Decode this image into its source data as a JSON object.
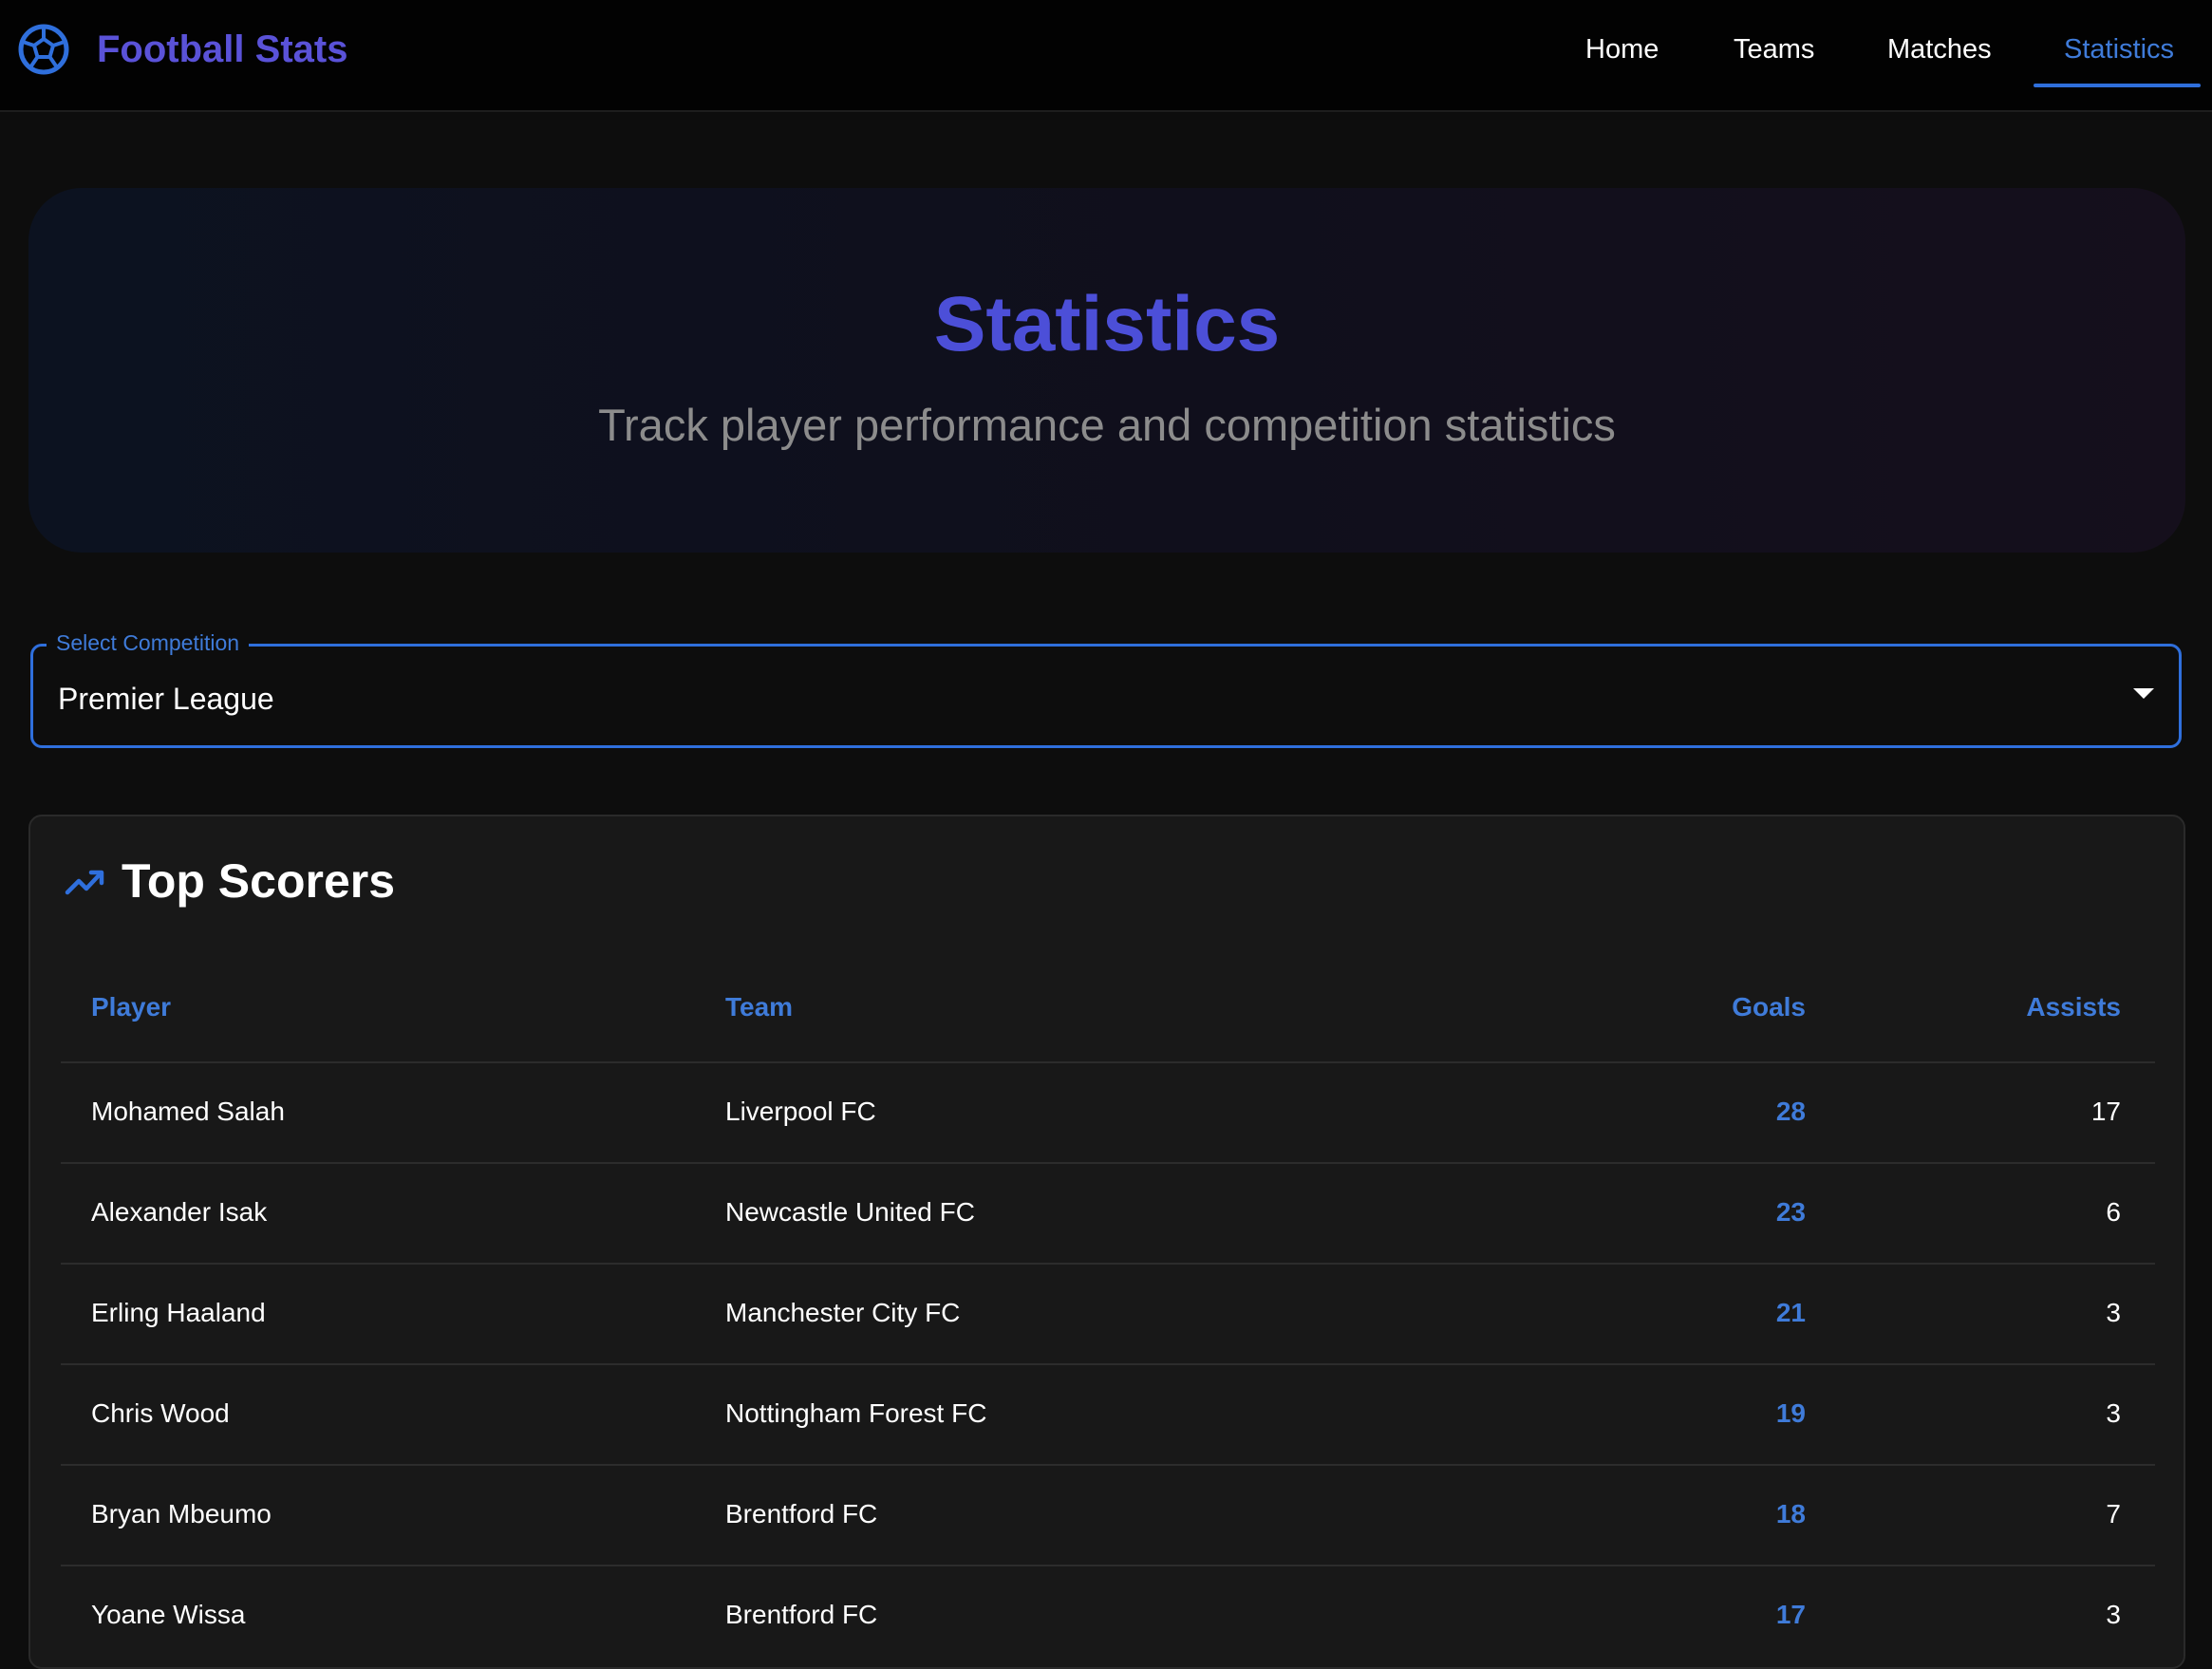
{
  "app": {
    "brand": "Football Stats",
    "brand_icon": "soccer-ball-icon",
    "accent": "#2f6fdc",
    "brand_color": "#5a52d8"
  },
  "nav": {
    "items": [
      {
        "label": "Home",
        "active": false
      },
      {
        "label": "Teams",
        "active": false
      },
      {
        "label": "Matches",
        "active": false
      },
      {
        "label": "Statistics",
        "active": true
      }
    ]
  },
  "hero": {
    "title": "Statistics",
    "subtitle": "Track player performance and competition statistics"
  },
  "competition_select": {
    "label": "Select Competition",
    "value": "Premier League",
    "icon": "caret-down-icon"
  },
  "top_scorers": {
    "title": "Top Scorers",
    "icon": "trending-up-icon",
    "columns": [
      "Player",
      "Team",
      "Goals",
      "Assists"
    ],
    "rows": [
      {
        "player": "Mohamed Salah",
        "team": "Liverpool FC",
        "goals": "28",
        "assists": "17"
      },
      {
        "player": "Alexander Isak",
        "team": "Newcastle United FC",
        "goals": "23",
        "assists": "6"
      },
      {
        "player": "Erling Haaland",
        "team": "Manchester City FC",
        "goals": "21",
        "assists": "3"
      },
      {
        "player": "Chris Wood",
        "team": "Nottingham Forest FC",
        "goals": "19",
        "assists": "3"
      },
      {
        "player": "Bryan Mbeumo",
        "team": "Brentford FC",
        "goals": "18",
        "assists": "7"
      },
      {
        "player": "Yoane Wissa",
        "team": "Brentford FC",
        "goals": "17",
        "assists": "3"
      }
    ]
  }
}
